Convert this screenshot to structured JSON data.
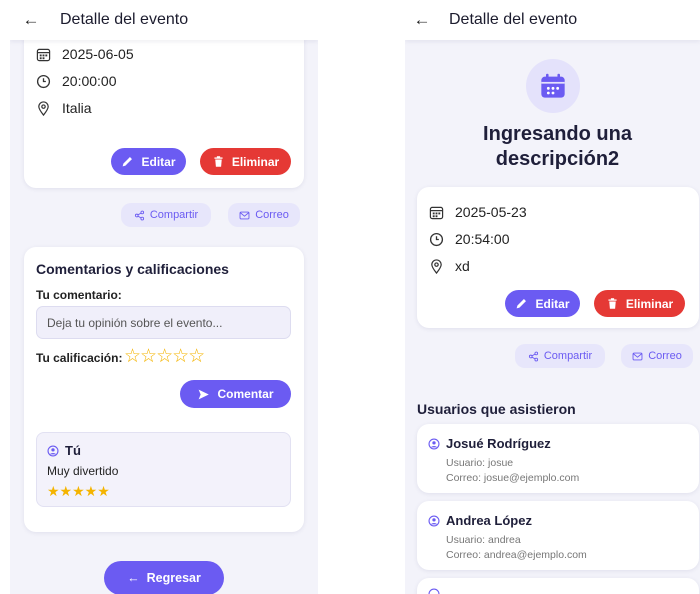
{
  "left": {
    "header": {
      "title": "Detalle del evento"
    },
    "event": {
      "date": "2025-06-05",
      "time": "20:00:00",
      "place": "Italia"
    },
    "actions": {
      "edit": "Editar",
      "delete": "Eliminar",
      "share": "Compartir",
      "mail": "Correo"
    },
    "comments": {
      "title": "Comentarios y calificaciones",
      "comment_label": "Tu comentario:",
      "comment_placeholder": "Deja tu opinión sobre el evento...",
      "rating_label": "Tu calificación:",
      "rating_stars": "☆☆☆☆☆",
      "submit": "Comentar",
      "items": [
        {
          "author": "Tú",
          "text": "Muy divertido",
          "stars": "★★★★★",
          "rating": 5
        }
      ]
    },
    "back_button": "Regresar"
  },
  "right": {
    "header": {
      "title": "Detalle del evento"
    },
    "event": {
      "title": "Ingresando una descripción2",
      "date": "2025-05-23",
      "time": "20:54:00",
      "place": "xd"
    },
    "actions": {
      "edit": "Editar",
      "delete": "Eliminar",
      "share": "Compartir",
      "mail": "Correo"
    },
    "attendees": {
      "title": "Usuarios que asistieron",
      "users": [
        {
          "name": "Josué Rodríguez",
          "user": "Usuario: josue",
          "email": "Correo: josue@ejemplo.com"
        },
        {
          "name": "Andrea López",
          "user": "Usuario: andrea",
          "email": "Correo: andrea@ejemplo.com"
        }
      ]
    }
  },
  "colors": {
    "primary": "#6b5bf2",
    "danger": "#e53935",
    "star": "#f4b400",
    "background": "#f3f3fa",
    "soft": "#e7e6fb"
  },
  "icons": {
    "back": "arrow-left-icon",
    "date": "calendar-icon",
    "time": "clock-icon",
    "place": "location-pin-icon",
    "edit": "pencil-icon",
    "delete": "trash-icon",
    "share": "share-icon",
    "mail": "envelope-icon",
    "send": "send-icon",
    "user": "user-circle-icon",
    "event": "calendar-event-icon"
  }
}
